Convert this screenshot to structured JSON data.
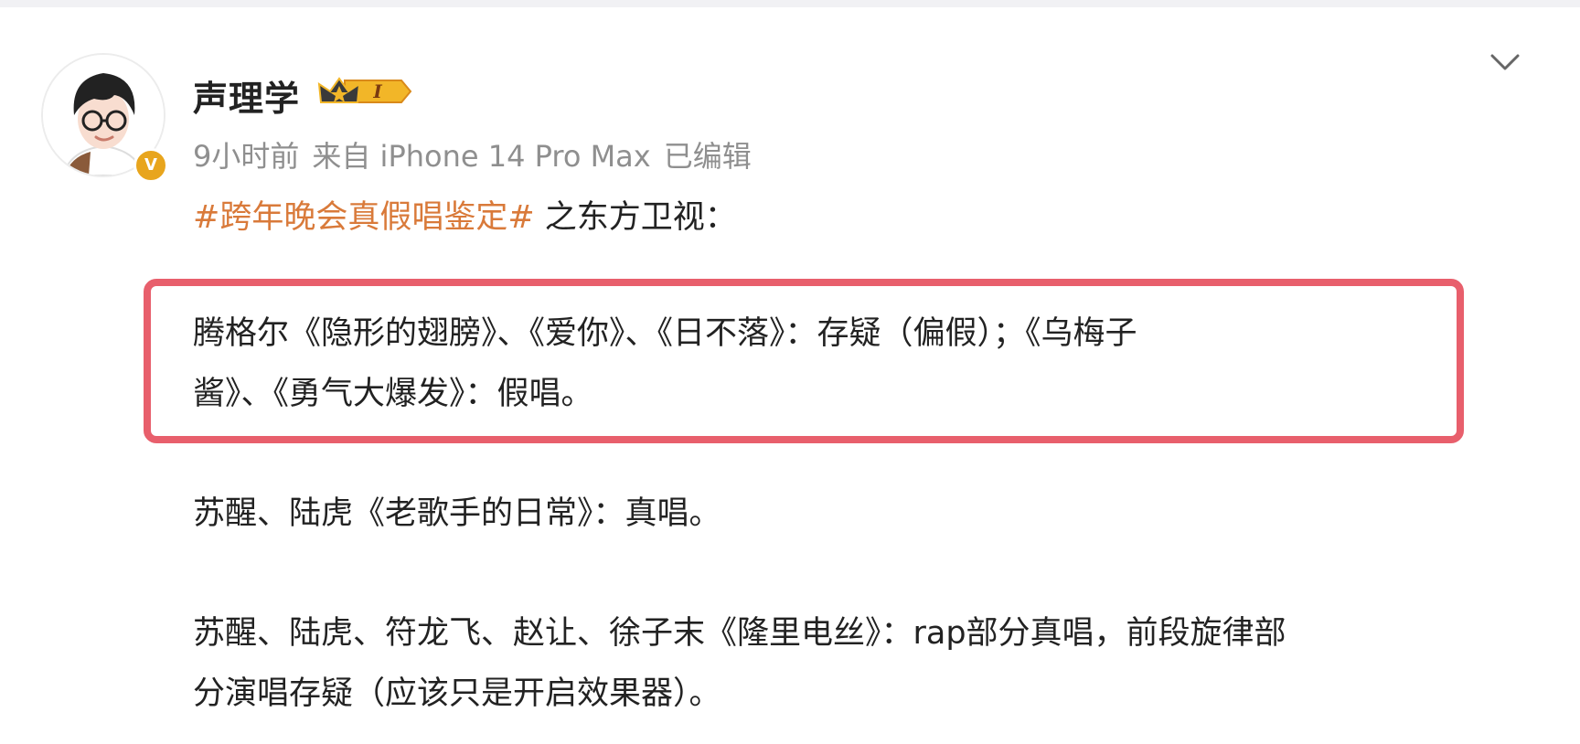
{
  "post": {
    "author": {
      "name": "声理学",
      "member_level": "I",
      "verified_mark": "V",
      "avatar_icon": "avatar-cartoon-icon"
    },
    "meta": {
      "time": "9小时前",
      "source": "来自 iPhone 14 Pro Max",
      "edited": "已编辑"
    },
    "menu_icon": "chevron-down-icon",
    "hashtag": "#跨年晚会真假唱鉴定#",
    "intro": "之东方卫视：",
    "paragraphs": [
      {
        "lines": [
          "腾格尔《隐形的翅膀》、《爱你》、《日不落》：存疑（偏假）；《乌梅子",
          "酱》、《勇气大爆发》：假唱。"
        ],
        "highlighted": true
      },
      {
        "lines": [
          "苏醒、陆虎《老歌手的日常》：真唱。"
        ],
        "highlighted": false
      },
      {
        "lines": [
          "苏醒、陆虎、符龙飞、赵让、徐子末《隆里电丝》：rap部分真唱，前段旋律部",
          "分演唱存疑（应该只是开启效果器）。"
        ],
        "highlighted": false
      }
    ]
  },
  "colors": {
    "hashtag": "#d97a3a",
    "highlight_border": "#e85f6c",
    "meta_text": "#8f8f8f",
    "verified_badge": "#e8a51d"
  }
}
